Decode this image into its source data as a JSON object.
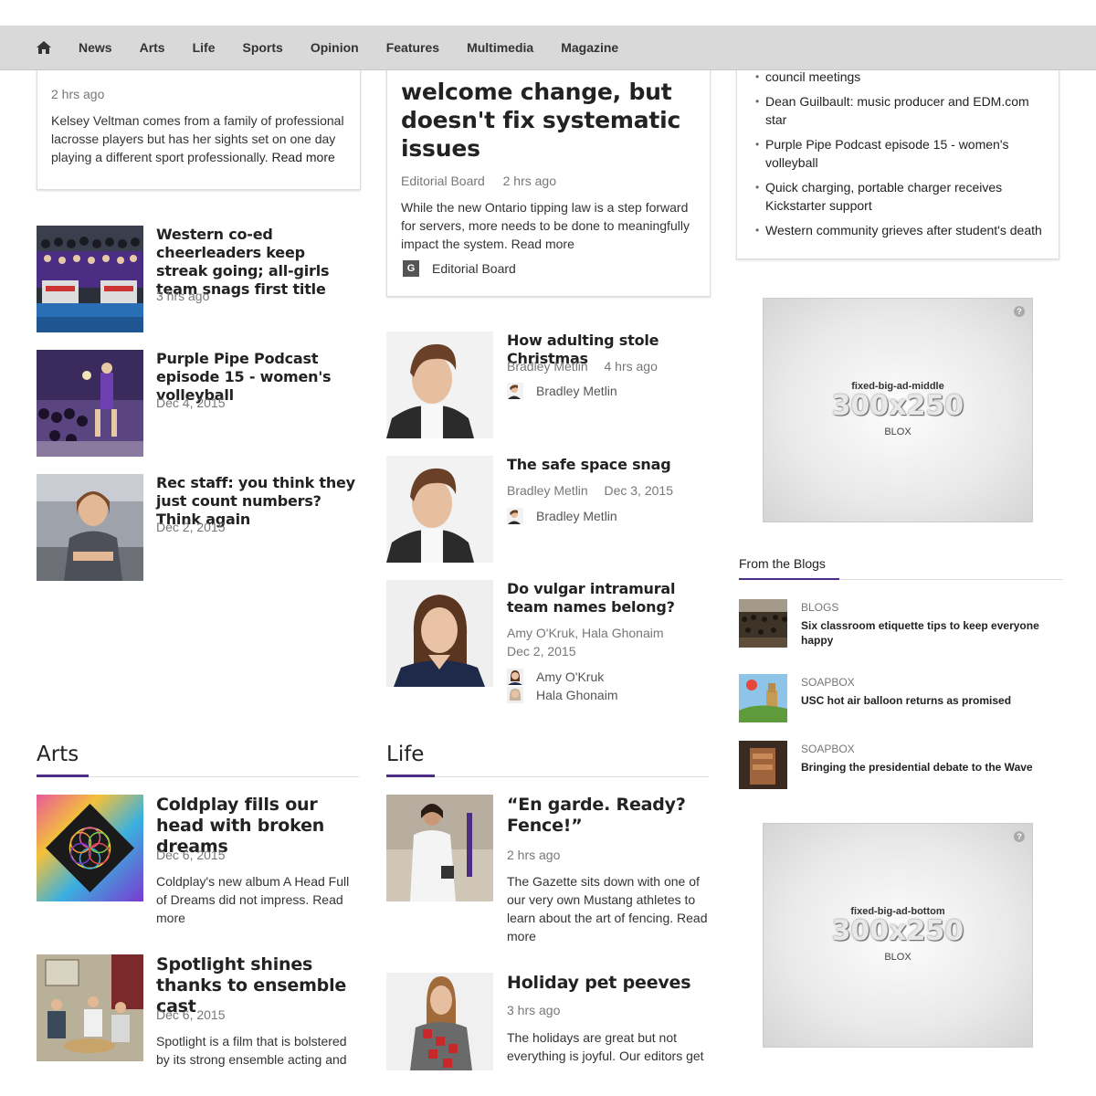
{
  "nav": {
    "items": [
      "News",
      "Arts",
      "Life",
      "Sports",
      "Opinion",
      "Features",
      "Multimedia",
      "Magazine"
    ]
  },
  "col1": {
    "top_card": {
      "time": "2 hrs ago",
      "summary": "Kelsey Veltman comes from a family of professional lacrosse players but has her sights set on one day playing a different sport professionally.",
      "read_more": "Read more"
    },
    "stories": [
      {
        "title": "Western co-ed cheerleaders keep streak going; all-girls team snags first title",
        "date": "3 hrs ago"
      },
      {
        "title": "Purple Pipe Podcast episode 15 - women's volleyball",
        "date": "Dec 4, 2015"
      },
      {
        "title": "Rec staff: you think they just count numbers? Think again",
        "date": "Dec 2, 2015"
      }
    ]
  },
  "col2": {
    "top_card": {
      "title": "welcome change, but doesn't fix systematic issues",
      "author": "Editorial Board",
      "time": "2 hrs ago",
      "summary": "While the new Ontario tipping law is a step forward for servers, more needs to be done to meaningfully impact the system.",
      "read_more": "Read more",
      "byline": "Editorial Board"
    },
    "stories": [
      {
        "title": "How adulting stole Christmas",
        "author": "Bradley Metlin",
        "date": "4 hrs ago",
        "byline": "Bradley Metlin"
      },
      {
        "title": "The safe space snag",
        "author": "Bradley Metlin",
        "date": "Dec 3, 2015",
        "byline": "Bradley Metlin"
      },
      {
        "title": "Do vulgar intramural team names belong?",
        "author": "Amy O'Kruk, Hala Ghonaim",
        "date": "Dec 2, 2015",
        "bylines": [
          "Amy O'Kruk",
          "Hala Ghonaim"
        ]
      }
    ]
  },
  "col3": {
    "trending": [
      "council meetings",
      "Dean Guilbault: music producer and EDM.com star",
      "Purple Pipe Podcast episode 15 - women's volleyball",
      "Quick charging, portable charger receives Kickstarter support",
      "Western community grieves after student's death"
    ],
    "ad_middle": {
      "label": "fixed-big-ad-middle",
      "size": "300x250",
      "brand": "BLOX",
      "help": "?"
    },
    "ad_bottom": {
      "label": "fixed-big-ad-bottom",
      "size": "300x250",
      "brand": "BLOX",
      "help": "?"
    },
    "blogs": {
      "title": "From the Blogs",
      "items": [
        {
          "kicker": "BLOGS",
          "title": "Six classroom etiquette tips to keep everyone happy"
        },
        {
          "kicker": "SOAPBOX",
          "title": "USC hot air balloon returns as promised"
        },
        {
          "kicker": "SOAPBOX",
          "title": "Bringing the presidential debate to the Wave"
        }
      ]
    }
  },
  "arts": {
    "title": "Arts",
    "stories": [
      {
        "title": "Coldplay fills our head with broken dreams",
        "date": "Dec 6, 2015",
        "summary": "Coldplay's new album A Head Full of Dreams did not impress.",
        "read_more": "Read more"
      },
      {
        "title": "Spotlight shines thanks to ensemble cast",
        "date": "Dec 6, 2015",
        "summary": "Spotlight is a film that is bolstered by its strong ensemble acting and"
      }
    ]
  },
  "life": {
    "title": "Life",
    "stories": [
      {
        "title": "“En garde. Ready? Fence!”",
        "date": "2 hrs ago",
        "summary": "The Gazette sits down with one of our very own Mustang athletes to learn about the art of fencing.",
        "read_more": "Read more"
      },
      {
        "title": "Holiday pet peeves",
        "date": "3 hrs ago",
        "summary": "The holidays are great but not everything is joyful. Our editors get"
      }
    ]
  },
  "colors": {
    "accent": "#4b2e83",
    "nav_bg": "#d9d9d9"
  }
}
